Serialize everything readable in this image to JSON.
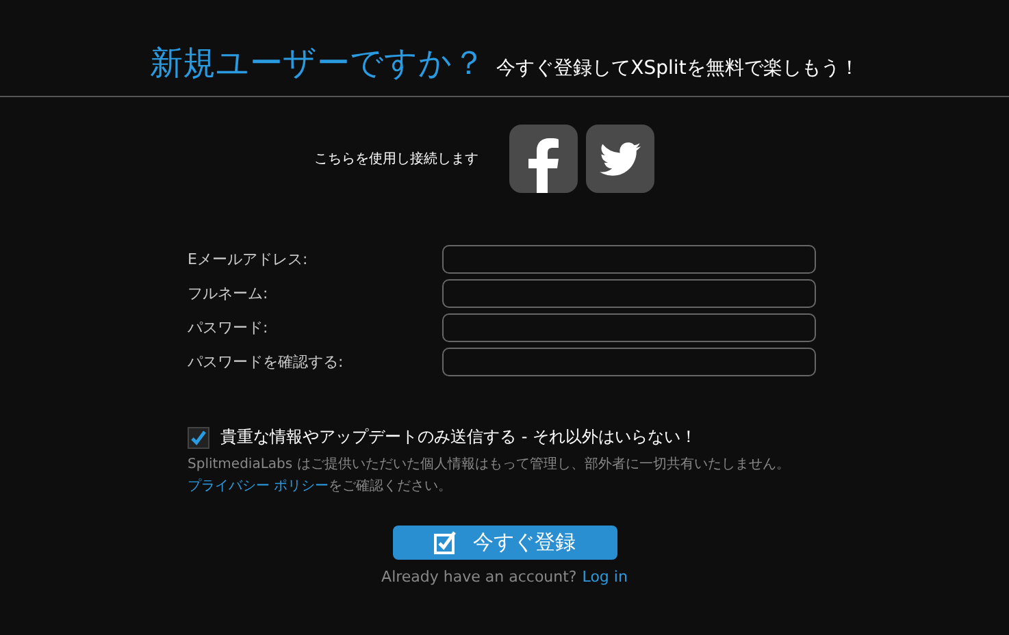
{
  "header": {
    "title": "新規ユーザーですか？",
    "subtitle": "今すぐ登録してXSplitを無料で楽しもう！"
  },
  "social": {
    "label": "こちらを使用し接続します",
    "buttons": [
      {
        "kind": "facebook"
      },
      {
        "kind": "twitter"
      }
    ]
  },
  "form": {
    "fields": [
      {
        "label": "Eメールアドレス:"
      },
      {
        "label": "フルネーム:"
      },
      {
        "label": "パスワード:"
      },
      {
        "label": "パスワードを確認する:"
      }
    ]
  },
  "newsletter": {
    "checked": true,
    "label": "貴重な情報やアップデートのみ送信する - それ以外はいらない！"
  },
  "privacy": {
    "text": "SplitmediaLabs はご提供いただいた個人情報はもって管理し、部外者に一切共有いたしません。",
    "link": "プライバシー ポリシー",
    "suffix": "をご確認ください。"
  },
  "submit": {
    "label": "今すぐ登録"
  },
  "login": {
    "prompt": "Already have an account?",
    "link": "Log in"
  }
}
